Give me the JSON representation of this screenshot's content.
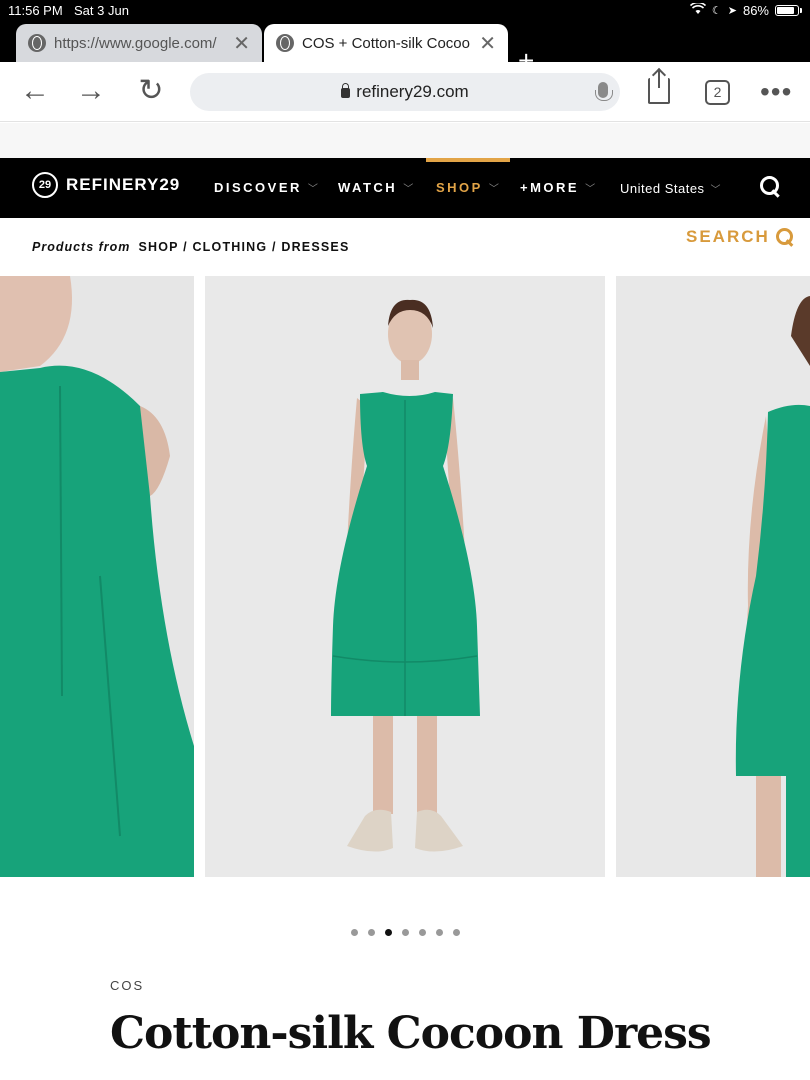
{
  "status_bar": {
    "time": "11:56 PM",
    "date": "Sat 3 Jun",
    "battery": "86%"
  },
  "tabs": [
    {
      "title": "https://www.google.com/",
      "active": false
    },
    {
      "title": "COS + Cotton-silk Cocoon Dress",
      "active": true
    }
  ],
  "toolbar": {
    "url": "refinery29.com",
    "tab_count": "2"
  },
  "site_nav": {
    "logo": "REFINERY29",
    "logo_mark": "29",
    "items": [
      "DISCOVER",
      "WATCH",
      "SHOP",
      "+MORE"
    ],
    "region": "United States"
  },
  "breadcrumb": {
    "prefix": "Products from",
    "path": "SHOP / CLOTHING / DRESSES"
  },
  "search_label": "SEARCH",
  "carousel": {
    "count": 7,
    "active_index": 2
  },
  "product": {
    "brand": "COS",
    "title": "Cotton-silk Cocoon Dress"
  },
  "colors": {
    "accent": "#e2a447",
    "dress": "#17a37a",
    "nav_bg": "#000000"
  }
}
